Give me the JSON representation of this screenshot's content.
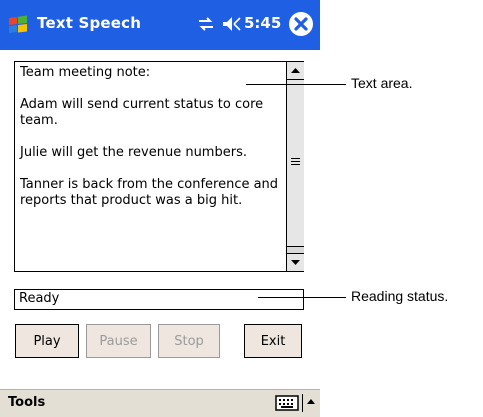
{
  "window": {
    "title": "Text Speech",
    "time": "5:45",
    "icons": {
      "start": "windows-flag-icon",
      "connectivity": "connectivity-icon",
      "volume": "speaker-icon",
      "close": "close-icon"
    }
  },
  "text_area": {
    "lines": [
      "Team meeting note:",
      "Adam will send current status to core team.",
      "Julie will get the revenue numbers.",
      "Tanner is back from the conference and reports that product was a big hit."
    ]
  },
  "status": {
    "value": "Ready"
  },
  "buttons": {
    "play": "Play",
    "pause": "Pause",
    "stop": "Stop",
    "exit": "Exit"
  },
  "menubar": {
    "tools": "Tools",
    "icons": {
      "keyboard": "keyboard-icon",
      "sip": "input-panel-arrow-icon"
    }
  },
  "callouts": {
    "text_area": "Text area.",
    "reading_status": "Reading status."
  },
  "colors": {
    "titlebar": "#1f5fe3",
    "button_face": "#efe7df",
    "menubar": "#e4dfd4",
    "disabled_text": "#9a9a9a"
  }
}
